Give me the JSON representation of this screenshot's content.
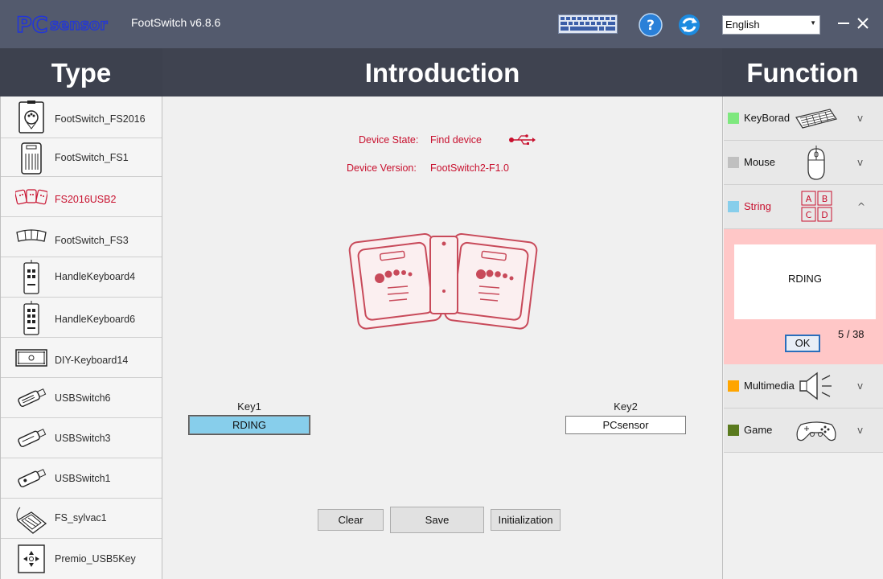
{
  "titlebar": {
    "logo_text": "PCsensor",
    "title": "FootSwitch v6.8.6",
    "language": "English"
  },
  "headers": {
    "type": "Type",
    "introduction": "Introduction",
    "function": "Function"
  },
  "types": [
    {
      "label": "FootSwitch_FS2016",
      "icon": "footswitch-fs2016-icon",
      "active": false
    },
    {
      "label": "FootSwitch_FS1",
      "icon": "footswitch-fs1-icon",
      "active": false
    },
    {
      "label": "FS2016USB2",
      "icon": "fs2016usb2-icon",
      "active": true
    },
    {
      "label": "FootSwitch_FS3",
      "icon": "footswitch-fs3-icon",
      "active": false
    },
    {
      "label": "HandleKeyboard4",
      "icon": "handle-keyboard4-icon",
      "active": false
    },
    {
      "label": "HandleKeyboard6",
      "icon": "handle-keyboard6-icon",
      "active": false
    },
    {
      "label": "DIY-Keyboard14",
      "icon": "diy-keyboard14-icon",
      "active": false
    },
    {
      "label": "USBSwitch6",
      "icon": "usbswitch6-icon",
      "active": false
    },
    {
      "label": "USBSwitch3",
      "icon": "usbswitch3-icon",
      "active": false
    },
    {
      "label": "USBSwitch1",
      "icon": "usbswitch1-icon",
      "active": false
    },
    {
      "label": "FS_sylvac1",
      "icon": "fs-sylvac1-icon",
      "active": false
    },
    {
      "label": "Premio_USB5Key",
      "icon": "premio-usb5key-icon",
      "active": false
    }
  ],
  "device": {
    "state_label": "Device State:",
    "state_value": "Find device",
    "version_label": "Device Version:",
    "version_value": "FootSwitch2-F1.0"
  },
  "keys": {
    "key1_label": "Key1",
    "key1_value": "RDING",
    "key2_label": "Key2",
    "key2_value": "PCsensor"
  },
  "buttons": {
    "clear": "Clear",
    "save": "Save",
    "init": "Initialization"
  },
  "functions": {
    "keyboard": {
      "label": "KeyBorad",
      "color": "#7ee87e",
      "chevron": "v"
    },
    "mouse": {
      "label": "Mouse",
      "color": "#c0c0c0",
      "chevron": "v"
    },
    "string": {
      "label": "String",
      "color": "#87ceeb",
      "chevron": "^",
      "letters": [
        "A",
        "B",
        "C",
        "D"
      ]
    },
    "multimedia": {
      "label": "Multimedia",
      "color": "#ffa500",
      "chevron": "v"
    },
    "game": {
      "label": "Game",
      "color": "#5a7a1e",
      "chevron": "v"
    }
  },
  "string_editor": {
    "text": "RDING",
    "ok": "OK",
    "counter": "5 / 38"
  },
  "colors": {
    "titlebar": "#535a6d",
    "header": "#3d414e",
    "accent_red": "#c8102e",
    "string_panel": "#ffc7c7"
  }
}
